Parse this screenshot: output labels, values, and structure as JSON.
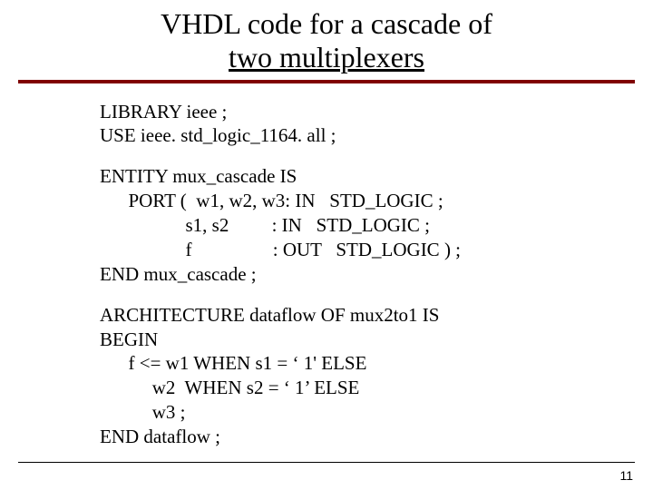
{
  "title": {
    "line1": "VHDL code for a cascade of",
    "line2": "two multiplexers"
  },
  "code": {
    "block1": "LIBRARY ieee ;\nUSE ieee. std_logic_1164. all ;",
    "block2": "ENTITY mux_cascade IS\n      PORT (  w1, w2, w3: IN   STD_LOGIC ;\n                  s1, s2         : IN   STD_LOGIC ;\n                  f                 : OUT   STD_LOGIC ) ;\nEND mux_cascade ;",
    "block3": "ARCHITECTURE dataflow OF mux2to1 IS\nBEGIN\n      f <= w1 WHEN s1 = ‘ 1' ELSE\n           w2  WHEN s2 = ‘ 1’ ELSE\n           w3 ;\nEND dataflow ;"
  },
  "page_number": "11"
}
